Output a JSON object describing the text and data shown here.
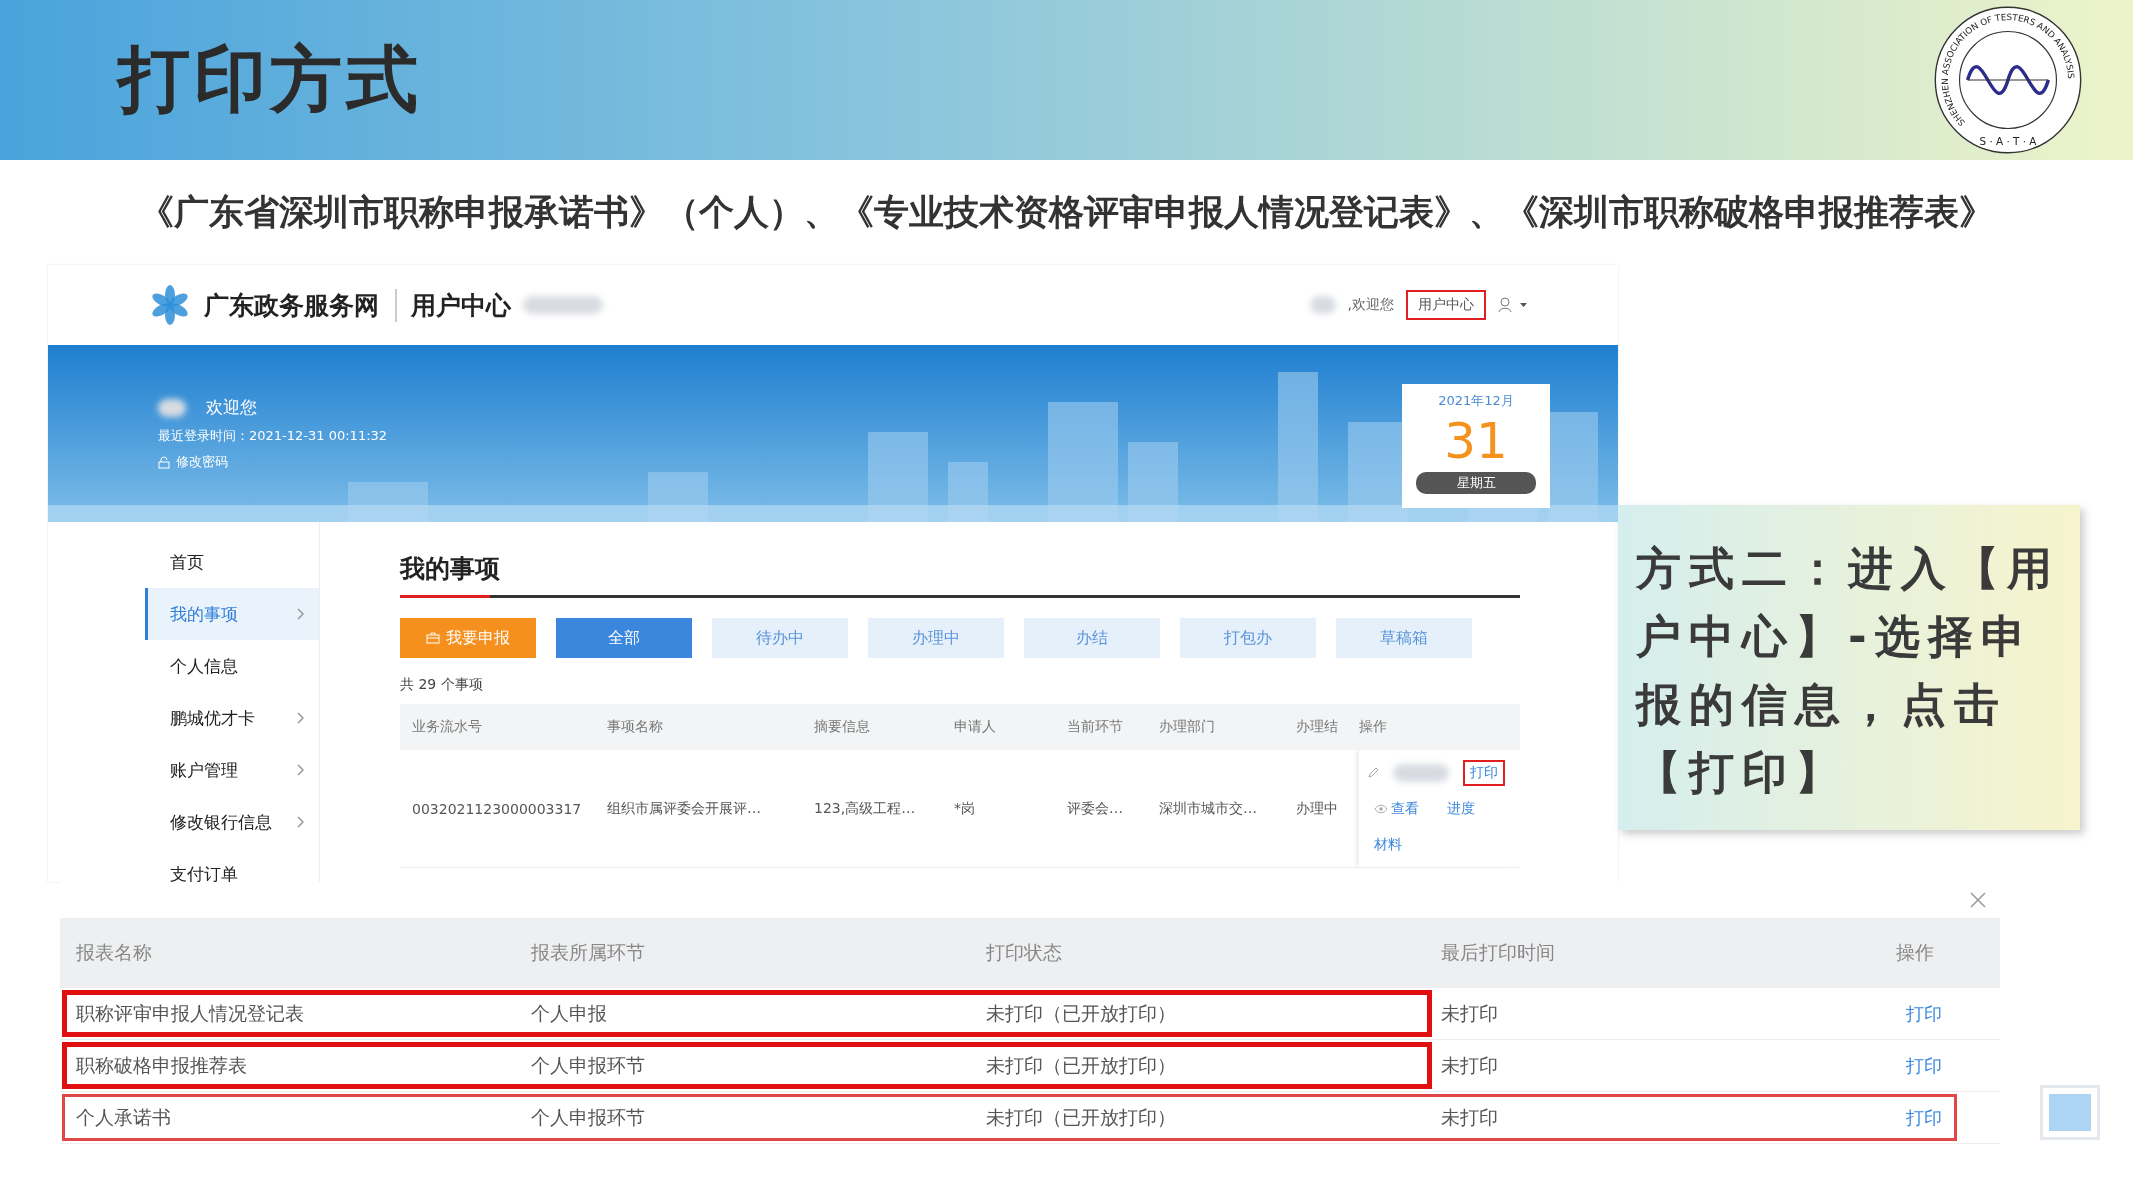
{
  "slide": {
    "title": "打印方式",
    "subtitle": "《广东省深圳市职称申报承诺书》（个人）、《专业技术资格评审申报人情况登记表》、《深圳市职称破格申报推荐表》",
    "logo": {
      "ring_text": "SHENZHEN ASSOCIATION OF TESTERS AND ANALYSIS",
      "letters": "S · A · T · A"
    }
  },
  "portal": {
    "site_name": "广东政务服务网",
    "section": "用户中心",
    "welcome": ",欢迎您",
    "user_center_link": {
      "label": "用户中心",
      "highlighted": true
    },
    "banner": {
      "greeting": "欢迎您",
      "last_login": "最近登录时间：2021-12-31 00:11:32",
      "change_password": "修改密码"
    },
    "calendar": {
      "month": "2021年12月",
      "day": "31",
      "weekday": "星期五"
    },
    "sidebar": [
      {
        "label": "首页",
        "selected": false,
        "expandable": false
      },
      {
        "label": "我的事项",
        "selected": true,
        "expandable": true
      },
      {
        "label": "个人信息",
        "selected": false,
        "expandable": false
      },
      {
        "label": "鹏城优才卡",
        "selected": false,
        "expandable": true
      },
      {
        "label": "账户管理",
        "selected": false,
        "expandable": true
      },
      {
        "label": "修改银行信息",
        "selected": false,
        "expandable": true
      },
      {
        "label": "支付订单",
        "selected": false,
        "expandable": false
      }
    ],
    "main": {
      "title": "我的事项",
      "apply_button": "我要申报",
      "filters": [
        {
          "label": "全部",
          "selected": true
        },
        {
          "label": "待办中",
          "selected": false
        },
        {
          "label": "办理中",
          "selected": false
        },
        {
          "label": "办结",
          "selected": false
        },
        {
          "label": "打包办",
          "selected": false
        },
        {
          "label": "草稿箱",
          "selected": false
        }
      ],
      "count": "共 29 个事项",
      "table": {
        "columns": [
          "业务流水号",
          "事项名称",
          "摘要信息",
          "申请人",
          "当前环节",
          "办理部门",
          "办理结",
          "操作"
        ],
        "rows": [
          {
            "cells": [
              "0032021123000003317",
              "组织市属评委会开展评…",
              "123,高级工程…",
              "*岗",
              "评委会…",
              "深圳市城市交…",
              "办理中"
            ],
            "actions": [
              {
                "label": "打印",
                "kind": "print",
                "highlighted": true
              },
              {
                "label": "查看",
                "kind": "view",
                "highlighted": false
              },
              {
                "label": "进度",
                "kind": "link",
                "highlighted": false
              },
              {
                "label": "材料",
                "kind": "link",
                "highlighted": false
              }
            ]
          }
        ]
      }
    }
  },
  "callout": {
    "text": "方式二：进入【用户中心】-选择申报的信息，点击【打印】"
  },
  "dialog": {
    "columns": [
      "报表名称",
      "报表所属环节",
      "打印状态",
      "最后打印时间",
      "操作"
    ],
    "rows": [
      {
        "cells": [
          "职称评审申报人情况登记表",
          "个人申报",
          "未打印（已开放打印）",
          "未打印"
        ],
        "action": "打印",
        "highlighted": true,
        "kind": "partial"
      },
      {
        "cells": [
          "职称破格申报推荐表",
          "个人申报环节",
          "未打印（已开放打印）",
          "未打印"
        ],
        "action": "打印",
        "highlighted": true,
        "kind": "partial"
      },
      {
        "cells": [
          "个人承诺书",
          "个人申报环节",
          "未打印（已开放打印）",
          "未打印"
        ],
        "action": "打印",
        "highlighted": true,
        "kind": "full"
      }
    ]
  }
}
